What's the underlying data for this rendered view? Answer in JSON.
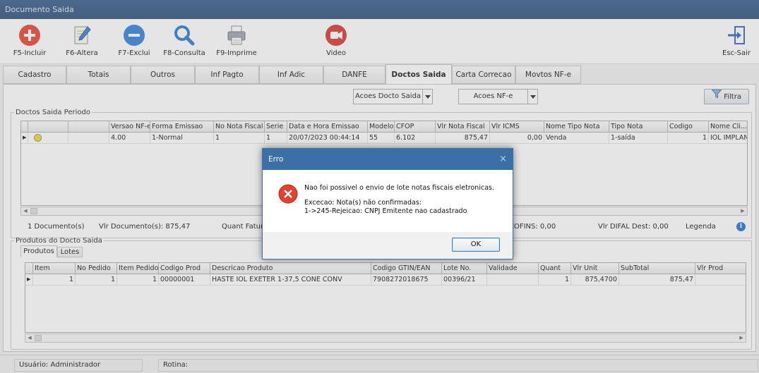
{
  "window": {
    "title": "Documento Saida"
  },
  "toolbar": {
    "incluir": "F5-Incluir",
    "altera": "F6-Altera",
    "exclui": "F7-Exclui",
    "consulta": "F8-Consulta",
    "imprime": "F9-Imprime",
    "video": "Video",
    "sair": "Esc-Sair"
  },
  "tabs": [
    "Cadastro",
    "Totais",
    "Outros",
    "Inf Pagto",
    "Inf Adic",
    "DANFE",
    "Doctos Saida",
    "Carta Correcao",
    "Movtos NF-e"
  ],
  "actions": {
    "acoes_docto": "Acoes Docto Saida",
    "acoes_nfe": "Acoes NF-e",
    "filtra": "Filtra"
  },
  "doctos": {
    "legend": "Doctos Saida Periodo",
    "columns": [
      "Versao NF-e",
      "Forma Emissao",
      "No Nota Fiscal",
      "Serie",
      "Data e Hora Emissao",
      "Modelo",
      "CFOP",
      "Vlr Nota Fiscal",
      "Vlr ICMS",
      "Nome Tipo Nota",
      "Tipo Nota",
      "Codigo",
      "Nome Cli..."
    ],
    "row": [
      "4.00",
      "1-Normal",
      "1",
      "1",
      "20/07/2023 00:44:14",
      "55",
      "6.102",
      "875,47",
      "0,00",
      "Venda",
      "1-saída",
      "1",
      "IOL IMPLAN"
    ],
    "status_color": "#e8d84a"
  },
  "summary": {
    "count": "1 Documento(s)",
    "valor": "Vlr Documento(s): 875,47",
    "quant": "Quant Fatura",
    "cofins": "COFINS: 0,00",
    "difal": "Vlr DIFAL Dest: 0,00",
    "legenda": "Legenda"
  },
  "produtos": {
    "legend": "Produtos do Docto Saida",
    "subtabs": [
      "Produtos",
      "Lotes"
    ],
    "columns": [
      "Item",
      "No Pedido",
      "Item Pedido",
      "Codigo Prod",
      "Descricao Produto",
      "Codigo GTIN/EAN",
      "Lote No.",
      "Validade",
      "Quant",
      "Vlr Unit",
      "SubTotal",
      "Vlr Prod"
    ],
    "row": [
      "1",
      "1",
      "1",
      "00000001",
      "HASTE IOL EXETER 1-37,5 CONE CONV",
      "7908272018675",
      "00396/21",
      "",
      "1",
      "875,4700",
      "875,47",
      ""
    ]
  },
  "statusbar": {
    "usuario": "Usuário: Administrador",
    "rotina": "Rotina:"
  },
  "dialog": {
    "title": "Erro",
    "message": "Nao foi possivel o envio de lote notas fiscais eletronicas.",
    "detail1": "Excecao: Nota(s) não confirmadas:",
    "detail2": "1->245-Rejeicao: CNPJ Emitente nao cadastrado",
    "ok": "OK"
  },
  "colors": {
    "titlebar": "#2f5482",
    "dialog_title": "#3b6fa6",
    "error": "#e2412e"
  }
}
